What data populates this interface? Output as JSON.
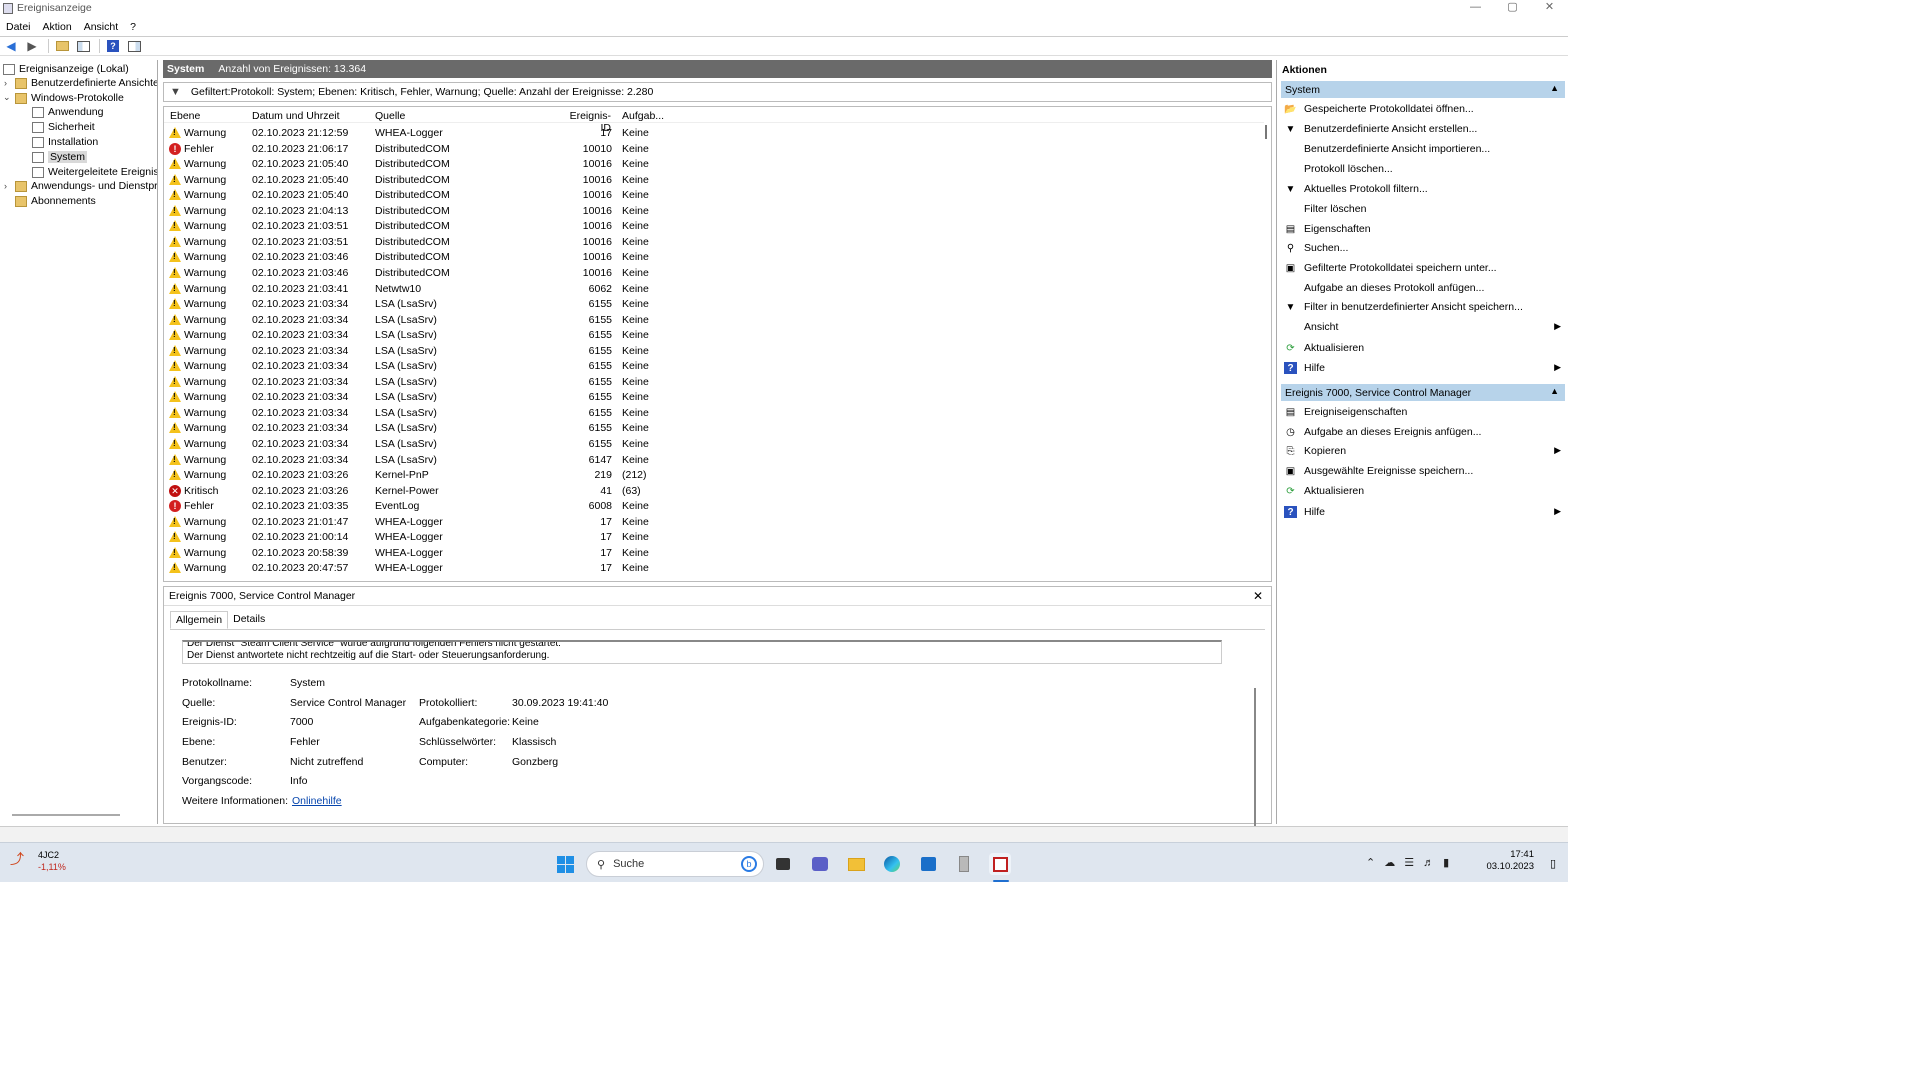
{
  "window": {
    "title": "Ereignisanzeige",
    "min": "—",
    "max": "▢",
    "close": "✕"
  },
  "menu": [
    "Datei",
    "Aktion",
    "Ansicht",
    "?"
  ],
  "tree": {
    "root": "Ereignisanzeige (Lokal)",
    "custom": "Benutzerdefinierte Ansichten",
    "winlogs": "Windows-Protokolle",
    "app": "Anwendung",
    "security": "Sicherheit",
    "setup": "Installation",
    "system": "System",
    "forwarded": "Weitergeleitete Ereignisse",
    "appsvc": "Anwendungs- und Dienstprotokolle",
    "subs": "Abonnements"
  },
  "center": {
    "log_name": "System",
    "event_count": "Anzahl von Ereignissen: 13.364",
    "filter_text": "Gefiltert:Protokoll: System; Ebenen: Kritisch, Fehler, Warnung; Quelle:  Anzahl der Ereignisse: 2.280",
    "columns": {
      "level": "Ebene",
      "date": "Datum und Uhrzeit",
      "source": "Quelle",
      "id": "Ereignis-ID",
      "task": "Aufgab..."
    },
    "rows": [
      {
        "level": "Warnung",
        "type": "warn",
        "date": "02.10.2023 21:12:59",
        "source": "WHEA-Logger",
        "id": "17",
        "task": "Keine"
      },
      {
        "level": "Fehler",
        "type": "err",
        "date": "02.10.2023 21:06:17",
        "source": "DistributedCOM",
        "id": "10010",
        "task": "Keine"
      },
      {
        "level": "Warnung",
        "type": "warn",
        "date": "02.10.2023 21:05:40",
        "source": "DistributedCOM",
        "id": "10016",
        "task": "Keine"
      },
      {
        "level": "Warnung",
        "type": "warn",
        "date": "02.10.2023 21:05:40",
        "source": "DistributedCOM",
        "id": "10016",
        "task": "Keine"
      },
      {
        "level": "Warnung",
        "type": "warn",
        "date": "02.10.2023 21:05:40",
        "source": "DistributedCOM",
        "id": "10016",
        "task": "Keine"
      },
      {
        "level": "Warnung",
        "type": "warn",
        "date": "02.10.2023 21:04:13",
        "source": "DistributedCOM",
        "id": "10016",
        "task": "Keine"
      },
      {
        "level": "Warnung",
        "type": "warn",
        "date": "02.10.2023 21:03:51",
        "source": "DistributedCOM",
        "id": "10016",
        "task": "Keine"
      },
      {
        "level": "Warnung",
        "type": "warn",
        "date": "02.10.2023 21:03:51",
        "source": "DistributedCOM",
        "id": "10016",
        "task": "Keine"
      },
      {
        "level": "Warnung",
        "type": "warn",
        "date": "02.10.2023 21:03:46",
        "source": "DistributedCOM",
        "id": "10016",
        "task": "Keine"
      },
      {
        "level": "Warnung",
        "type": "warn",
        "date": "02.10.2023 21:03:46",
        "source": "DistributedCOM",
        "id": "10016",
        "task": "Keine"
      },
      {
        "level": "Warnung",
        "type": "warn",
        "date": "02.10.2023 21:03:41",
        "source": "Netwtw10",
        "id": "6062",
        "task": "Keine"
      },
      {
        "level": "Warnung",
        "type": "warn",
        "date": "02.10.2023 21:03:34",
        "source": "LSA (LsaSrv)",
        "id": "6155",
        "task": "Keine"
      },
      {
        "level": "Warnung",
        "type": "warn",
        "date": "02.10.2023 21:03:34",
        "source": "LSA (LsaSrv)",
        "id": "6155",
        "task": "Keine"
      },
      {
        "level": "Warnung",
        "type": "warn",
        "date": "02.10.2023 21:03:34",
        "source": "LSA (LsaSrv)",
        "id": "6155",
        "task": "Keine"
      },
      {
        "level": "Warnung",
        "type": "warn",
        "date": "02.10.2023 21:03:34",
        "source": "LSA (LsaSrv)",
        "id": "6155",
        "task": "Keine"
      },
      {
        "level": "Warnung",
        "type": "warn",
        "date": "02.10.2023 21:03:34",
        "source": "LSA (LsaSrv)",
        "id": "6155",
        "task": "Keine"
      },
      {
        "level": "Warnung",
        "type": "warn",
        "date": "02.10.2023 21:03:34",
        "source": "LSA (LsaSrv)",
        "id": "6155",
        "task": "Keine"
      },
      {
        "level": "Warnung",
        "type": "warn",
        "date": "02.10.2023 21:03:34",
        "source": "LSA (LsaSrv)",
        "id": "6155",
        "task": "Keine"
      },
      {
        "level": "Warnung",
        "type": "warn",
        "date": "02.10.2023 21:03:34",
        "source": "LSA (LsaSrv)",
        "id": "6155",
        "task": "Keine"
      },
      {
        "level": "Warnung",
        "type": "warn",
        "date": "02.10.2023 21:03:34",
        "source": "LSA (LsaSrv)",
        "id": "6155",
        "task": "Keine"
      },
      {
        "level": "Warnung",
        "type": "warn",
        "date": "02.10.2023 21:03:34",
        "source": "LSA (LsaSrv)",
        "id": "6155",
        "task": "Keine"
      },
      {
        "level": "Warnung",
        "type": "warn",
        "date": "02.10.2023 21:03:34",
        "source": "LSA (LsaSrv)",
        "id": "6147",
        "task": "Keine"
      },
      {
        "level": "Warnung",
        "type": "warn",
        "date": "02.10.2023 21:03:26",
        "source": "Kernel-PnP",
        "id": "219",
        "task": "(212)"
      },
      {
        "level": "Kritisch",
        "type": "crit",
        "date": "02.10.2023 21:03:26",
        "source": "Kernel-Power",
        "id": "41",
        "task": "(63)"
      },
      {
        "level": "Fehler",
        "type": "err",
        "date": "02.10.2023 21:03:35",
        "source": "EventLog",
        "id": "6008",
        "task": "Keine"
      },
      {
        "level": "Warnung",
        "type": "warn",
        "date": "02.10.2023 21:01:47",
        "source": "WHEA-Logger",
        "id": "17",
        "task": "Keine"
      },
      {
        "level": "Warnung",
        "type": "warn",
        "date": "02.10.2023 21:00:14",
        "source": "WHEA-Logger",
        "id": "17",
        "task": "Keine"
      },
      {
        "level": "Warnung",
        "type": "warn",
        "date": "02.10.2023 20:58:39",
        "source": "WHEA-Logger",
        "id": "17",
        "task": "Keine"
      },
      {
        "level": "Warnung",
        "type": "warn",
        "date": "02.10.2023 20:47:57",
        "source": "WHEA-Logger",
        "id": "17",
        "task": "Keine"
      }
    ]
  },
  "detail": {
    "title": "Ereignis 7000, Service Control Manager",
    "tab_general": "Allgemein",
    "tab_details": "Details",
    "msg_line1": "Der Dienst \"Steam Client Service\" wurde aufgrund folgenden Fehlers nicht gestartet:",
    "msg_line2": "Der Dienst antwortete nicht rechtzeitig auf die Start- oder Steuerungsanforderung.",
    "l_logname": "Protokollname:",
    "v_logname": "System",
    "l_source": "Quelle:",
    "v_source": "Service Control Manager",
    "l_logged": "Protokolliert:",
    "v_logged": "30.09.2023 19:41:40",
    "l_id": "Ereignis-ID:",
    "v_id": "7000",
    "l_taskcat": "Aufgabenkategorie:",
    "v_taskcat": "Keine",
    "l_level": "Ebene:",
    "v_level": "Fehler",
    "l_keywords": "Schlüsselwörter:",
    "v_keywords": "Klassisch",
    "l_user": "Benutzer:",
    "v_user": "Nicht zutreffend",
    "l_computer": "Computer:",
    "v_computer": "Gonzberg",
    "l_opcode": "Vorgangscode:",
    "v_opcode": "Info",
    "l_more": "Weitere Informationen:",
    "v_more": "Onlinehilfe"
  },
  "actions": {
    "title": "Aktionen",
    "sec1": "System",
    "items1": [
      "Gespeicherte Protokolldatei öffnen...",
      "Benutzerdefinierte Ansicht erstellen...",
      "Benutzerdefinierte Ansicht importieren...",
      "Protokoll löschen...",
      "Aktuelles Protokoll filtern...",
      "Filter löschen",
      "Eigenschaften",
      "Suchen...",
      "Gefilterte Protokolldatei speichern unter...",
      "Aufgabe an dieses Protokoll anfügen...",
      "Filter in benutzerdefinierter Ansicht speichern...",
      "Ansicht",
      "Aktualisieren",
      "Hilfe"
    ],
    "sec2": "Ereignis 7000, Service Control Manager",
    "items2": [
      "Ereigniseigenschaften",
      "Aufgabe an dieses Ereignis anfügen...",
      "Kopieren",
      "Ausgewählte Ereignisse speichern...",
      "Aktualisieren",
      "Hilfe"
    ]
  },
  "taskbar": {
    "stock_name": "4JC2",
    "stock_change": "-1,11%",
    "search": "Suche",
    "time": "17:41",
    "date": "03.10.2023"
  }
}
